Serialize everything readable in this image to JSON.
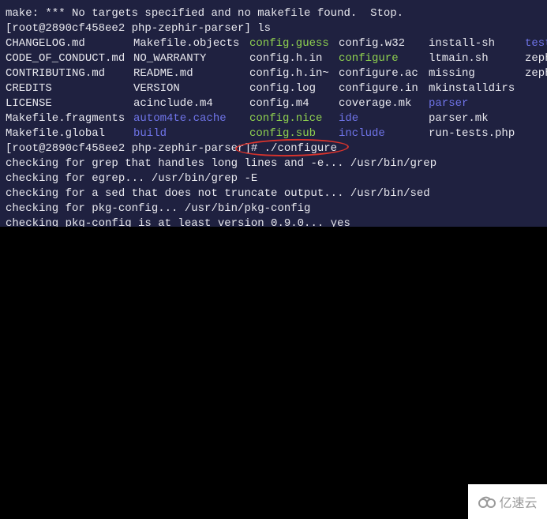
{
  "terminal": {
    "lines": [
      "make: *** No targets specified and no makefile found.  Stop.",
      "[root@2890cf458ee2 php-zephir-parser] ls"
    ],
    "ls_rows": [
      [
        {
          "t": "CHANGELOG.md",
          "c": ""
        },
        {
          "t": "Makefile.objects",
          "c": ""
        },
        {
          "t": "config.guess",
          "c": "green"
        },
        {
          "t": "config.w32",
          "c": ""
        },
        {
          "t": "install-sh",
          "c": ""
        },
        {
          "t": "test",
          "c": "blue"
        }
      ],
      [
        {
          "t": "CODE_OF_CONDUCT.md",
          "c": ""
        },
        {
          "t": "NO_WARRANTY",
          "c": ""
        },
        {
          "t": "config.h.in",
          "c": ""
        },
        {
          "t": "configure",
          "c": "green"
        },
        {
          "t": "ltmain.sh",
          "c": ""
        },
        {
          "t": "zeph",
          "c": ""
        }
      ],
      [
        {
          "t": "CONTRIBUTING.md",
          "c": ""
        },
        {
          "t": "README.md",
          "c": ""
        },
        {
          "t": "config.h.in~",
          "c": ""
        },
        {
          "t": "configure.ac",
          "c": ""
        },
        {
          "t": "missing",
          "c": ""
        },
        {
          "t": "zeph",
          "c": ""
        }
      ],
      [
        {
          "t": "CREDITS",
          "c": ""
        },
        {
          "t": "VERSION",
          "c": ""
        },
        {
          "t": "config.log",
          "c": ""
        },
        {
          "t": "configure.in",
          "c": ""
        },
        {
          "t": "mkinstalldirs",
          "c": ""
        },
        {
          "t": "",
          "c": ""
        }
      ],
      [
        {
          "t": "LICENSE",
          "c": ""
        },
        {
          "t": "acinclude.m4",
          "c": ""
        },
        {
          "t": "config.m4",
          "c": ""
        },
        {
          "t": "coverage.mk",
          "c": ""
        },
        {
          "t": "parser",
          "c": "blue"
        },
        {
          "t": "",
          "c": ""
        }
      ],
      [
        {
          "t": "Makefile.fragments",
          "c": ""
        },
        {
          "t": "autom4te.cache",
          "c": "blue"
        },
        {
          "t": "config.nice",
          "c": "green"
        },
        {
          "t": "ide",
          "c": "blue"
        },
        {
          "t": "parser.mk",
          "c": ""
        },
        {
          "t": "",
          "c": ""
        }
      ],
      [
        {
          "t": "Makefile.global",
          "c": ""
        },
        {
          "t": "build",
          "c": "blue"
        },
        {
          "t": "config.sub",
          "c": "green"
        },
        {
          "t": "include",
          "c": "blue"
        },
        {
          "t": "run-tests.php",
          "c": ""
        },
        {
          "t": "",
          "c": ""
        }
      ]
    ],
    "after_lines": [
      "[root@2890cf458ee2 php-zephir-parser]# ./configure",
      "checking for grep that handles long lines and -e... /usr/bin/grep",
      "checking for egrep... /usr/bin/grep -E",
      "checking for a sed that does not truncate output... /usr/bin/sed",
      "checking for pkg-config... /usr/bin/pkg-config",
      "checking pkg-config is at least version 0.9.0... yes"
    ],
    "colors": {
      "background": "#1f2140",
      "executable": "#8fd14f",
      "directory": "#6f74e8",
      "annotation": "#d8332c"
    }
  },
  "watermark": {
    "text": "亿速云",
    "icon": "cloud-logo-icon"
  }
}
